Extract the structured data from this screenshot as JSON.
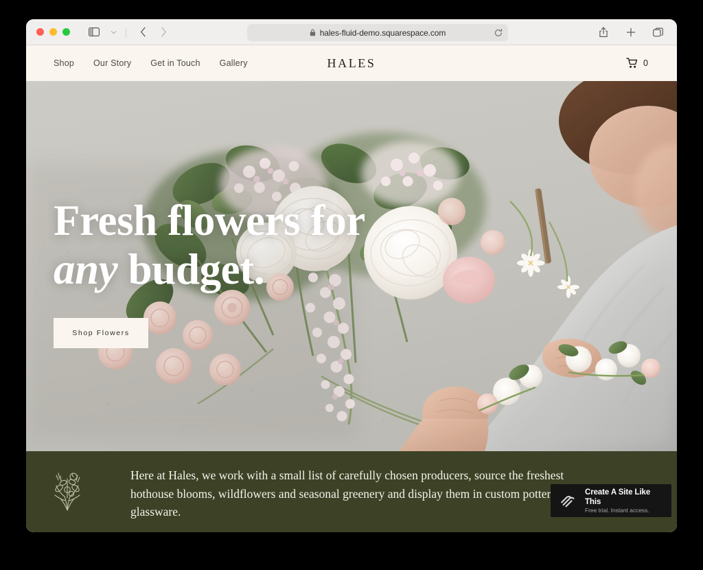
{
  "browser": {
    "traffic_lights": [
      "close",
      "minimize",
      "maximize"
    ],
    "sidebar_icon": "sidebar-icon",
    "sidebar_menu_icon": "chevron-down-icon",
    "back_icon": "chevron-left-icon",
    "forward_icon": "chevron-right-icon",
    "url": "hales-fluid-demo.squarespace.com",
    "lock_icon": "lock-icon",
    "reload_icon": "reload-icon",
    "share_icon": "share-icon",
    "new_tab_icon": "plus-icon",
    "tabs_icon": "tab-overview-icon"
  },
  "site": {
    "logo": "HALES",
    "nav": [
      {
        "label": "Shop"
      },
      {
        "label": "Our Story"
      },
      {
        "label": "Get in Touch"
      },
      {
        "label": "Gallery"
      }
    ],
    "cart": {
      "icon": "shopping-cart-icon",
      "count": "0"
    },
    "hero": {
      "heading_line1": "Fresh flowers for",
      "heading_italic": "any",
      "heading_rest": " budget.",
      "cta_label": "Shop Flowers",
      "image_alt": "florist arranging a bouquet of white peonies and blush roses"
    },
    "intro": {
      "mark_icon": "bouquet-illustration-icon",
      "text": "Here at Hales, we work with a small list of carefully chosen producers, source the freshest hothouse blooms, wildflowers and seasonal greenery and display them in custom pottery and glassware."
    }
  },
  "promo": {
    "logo_icon": "squarespace-logo-icon",
    "title": "Create A Site Like This",
    "subtitle": "Free trial. Instant access."
  },
  "colors": {
    "cream": "#faf5ef",
    "olive": "#3d4226",
    "toolbar": "#f0efee",
    "badge_bg": "#151515",
    "page_backdrop": "#000000"
  }
}
